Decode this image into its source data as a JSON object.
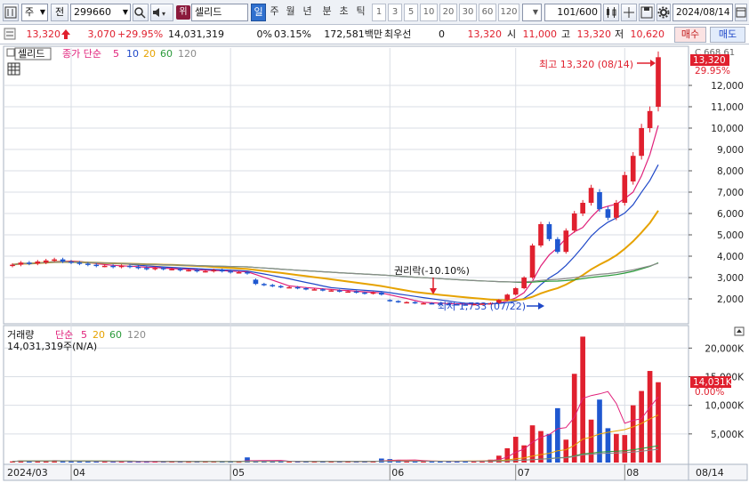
{
  "toolbar": {
    "type_label": "주",
    "jeon_label": "전",
    "code": "299660",
    "badge": "위",
    "name": "셀리드",
    "periods": [
      "일",
      "주",
      "월",
      "년",
      "분",
      "초",
      "틱"
    ],
    "active_period": "일",
    "intervals": [
      "1",
      "3",
      "5",
      "10",
      "20",
      "30",
      "60",
      "120"
    ],
    "count": "101",
    "count_total": "/600",
    "date": "2024/08/14"
  },
  "quote": {
    "price": "13,320",
    "change": "3,070",
    "change_pct": "+29.95%",
    "volume": "14,031,319",
    "turnover_pct": "0%",
    "rate": "03.15%",
    "amount": "172,581백만",
    "best_label": "최우선",
    "best_qty": "0",
    "best_price": "13,320",
    "open_label": "시",
    "open": "11,000",
    "high_label": "고",
    "high": "13,320",
    "low_label": "저",
    "low": "10,620",
    "buy_label": "매수",
    "sell_label": "매도"
  },
  "price_panel": {
    "name_tag": "셀리드",
    "legend_head": "종가 단순",
    "ma_periods": [
      "5",
      "10",
      "20",
      "60",
      "120"
    ],
    "ma_colors": [
      "#e0207a",
      "#1f48c8",
      "#e6a200",
      "#2a9a3a",
      "#8a8a8a"
    ],
    "high_annot": "최고 13,320 (08/14)",
    "low_annot": "최저 1,733 (07/22)",
    "rights_annot": "권리락(-10.10%)",
    "axis_top_label": "C 668.61",
    "current_price_tag": "13,320",
    "current_pct_tag": "29.95%",
    "y_ticks": [
      "12,000",
      "11,000",
      "10,000",
      "9,000",
      "8,000",
      "7,000",
      "6,000",
      "5,000",
      "4,000",
      "3,000",
      "2,000"
    ]
  },
  "volume_panel": {
    "title": "거래량",
    "legend_head": "단순",
    "ma_periods": [
      "5",
      "20",
      "60",
      "120"
    ],
    "ma_colors": [
      "#e0207a",
      "#e6a200",
      "#2a9a3a",
      "#8a8a8a"
    ],
    "value_label": "14,031,319주(N/A)",
    "current_tag": "14,031K",
    "current_pct_tag": "0.00%",
    "y_ticks": [
      "20,000K",
      "15,000K",
      "10,000K",
      "5,000K"
    ]
  },
  "x_axis": {
    "labels": [
      "2024/03",
      "04",
      "05",
      "06",
      "07",
      "08"
    ],
    "end_label": "08/14"
  },
  "colors": {
    "up": "#e0202e",
    "down": "#1f58d0",
    "grid": "#d9dde4"
  },
  "chart_data": {
    "type": "candlestick",
    "y_range": [
      1000,
      13500
    ],
    "volume_range": [
      0,
      23000
    ],
    "price": {
      "open": [
        3550,
        3600,
        3700,
        3650,
        3700,
        3800,
        3850,
        3750,
        3700,
        3650,
        3600,
        3550,
        3550,
        3500,
        3550,
        3500,
        3450,
        3400,
        3450,
        3400,
        3400,
        3350,
        3350,
        3300,
        3300,
        3350,
        3300,
        3250,
        3250,
        2900,
        2700,
        2650,
        2600,
        2550,
        2550,
        2500,
        2450,
        2450,
        2400,
        2400,
        2350,
        2350,
        2300,
        2250,
        2300,
        1950,
        1900,
        1850,
        1850,
        1800,
        1800,
        1780,
        1760,
        1750,
        1740,
        1733,
        1760,
        1780,
        1800,
        1950,
        2200,
        2500,
        3000,
        4500,
        5500,
        4800,
        4200,
        5200,
        6000,
        6500,
        7000,
        6200,
        5800,
        6500,
        7500,
        8700,
        10000,
        11000
      ],
      "close": [
        3600,
        3700,
        3650,
        3750,
        3800,
        3850,
        3750,
        3700,
        3650,
        3600,
        3550,
        3550,
        3500,
        3550,
        3500,
        3450,
        3400,
        3450,
        3400,
        3400,
        3350,
        3350,
        3300,
        3300,
        3350,
        3300,
        3250,
        3250,
        3200,
        2700,
        2650,
        2600,
        2550,
        2550,
        2500,
        2450,
        2450,
        2400,
        2400,
        2350,
        2350,
        2300,
        2250,
        2300,
        2200,
        1900,
        1850,
        1850,
        1800,
        1800,
        1780,
        1760,
        1750,
        1740,
        1733,
        1760,
        1780,
        1800,
        1950,
        2200,
        2500,
        3000,
        4500,
        5500,
        4800,
        4200,
        5200,
        6000,
        6500,
        7200,
        6200,
        5800,
        6500,
        7800,
        8700,
        10000,
        10800,
        13320
      ]
    },
    "volume_k": [
      200,
      350,
      300,
      250,
      300,
      400,
      280,
      250,
      200,
      180,
      200,
      220,
      150,
      180,
      160,
      150,
      140,
      170,
      150,
      160,
      150,
      140,
      150,
      160,
      200,
      180,
      150,
      140,
      900,
      300,
      200,
      250,
      200,
      180,
      200,
      220,
      150,
      160,
      180,
      170,
      160,
      150,
      180,
      200,
      700,
      600,
      400,
      300,
      250,
      220,
      200,
      180,
      200,
      250,
      300,
      280,
      350,
      500,
      1200,
      2500,
      4500,
      3000,
      6500,
      5500,
      5000,
      9500,
      4000,
      15500,
      22000,
      7500,
      11000,
      6000,
      5000,
      4800,
      10000,
      12500,
      16000,
      14031
    ],
    "annotations": {
      "high": {
        "value": 13320,
        "date": "08/14"
      },
      "low": {
        "value": 1733,
        "date": "07/22"
      },
      "rights": "-10.10%"
    }
  }
}
